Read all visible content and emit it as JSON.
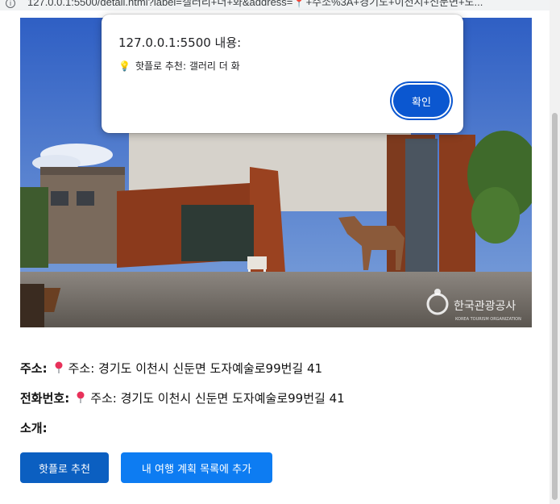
{
  "browser": {
    "url": "127.0.0.1:5500/detail.html?label=갤러리+더+화&address=📍+주소%3A+경기도+이천시+신둔면+도..."
  },
  "hero": {
    "watermark": "한국관광공사",
    "watermark_sub": "KOREA TOURISM ORGANIZATION"
  },
  "details": {
    "address_label": "주소:",
    "address_value": "주소: 경기도 이천시 신둔면 도자예술로99번길 41",
    "phone_label": "전화번호:",
    "phone_value": "주소: 경기도 이천시 신둔면 도자예술로99번길 41",
    "intro_label": "소개:"
  },
  "buttons": {
    "recommend": "핫플로 추천",
    "add_plan": "내 여행 계획 목록에 추가"
  },
  "dialog": {
    "title": "127.0.0.1:5500 내용:",
    "message": "핫플로 추천: 갤러리 더 화",
    "ok": "확인"
  },
  "colors": {
    "primary": "#0b5fc1",
    "secondary": "#0d7cf2",
    "dialog_button": "#0b57d0"
  }
}
